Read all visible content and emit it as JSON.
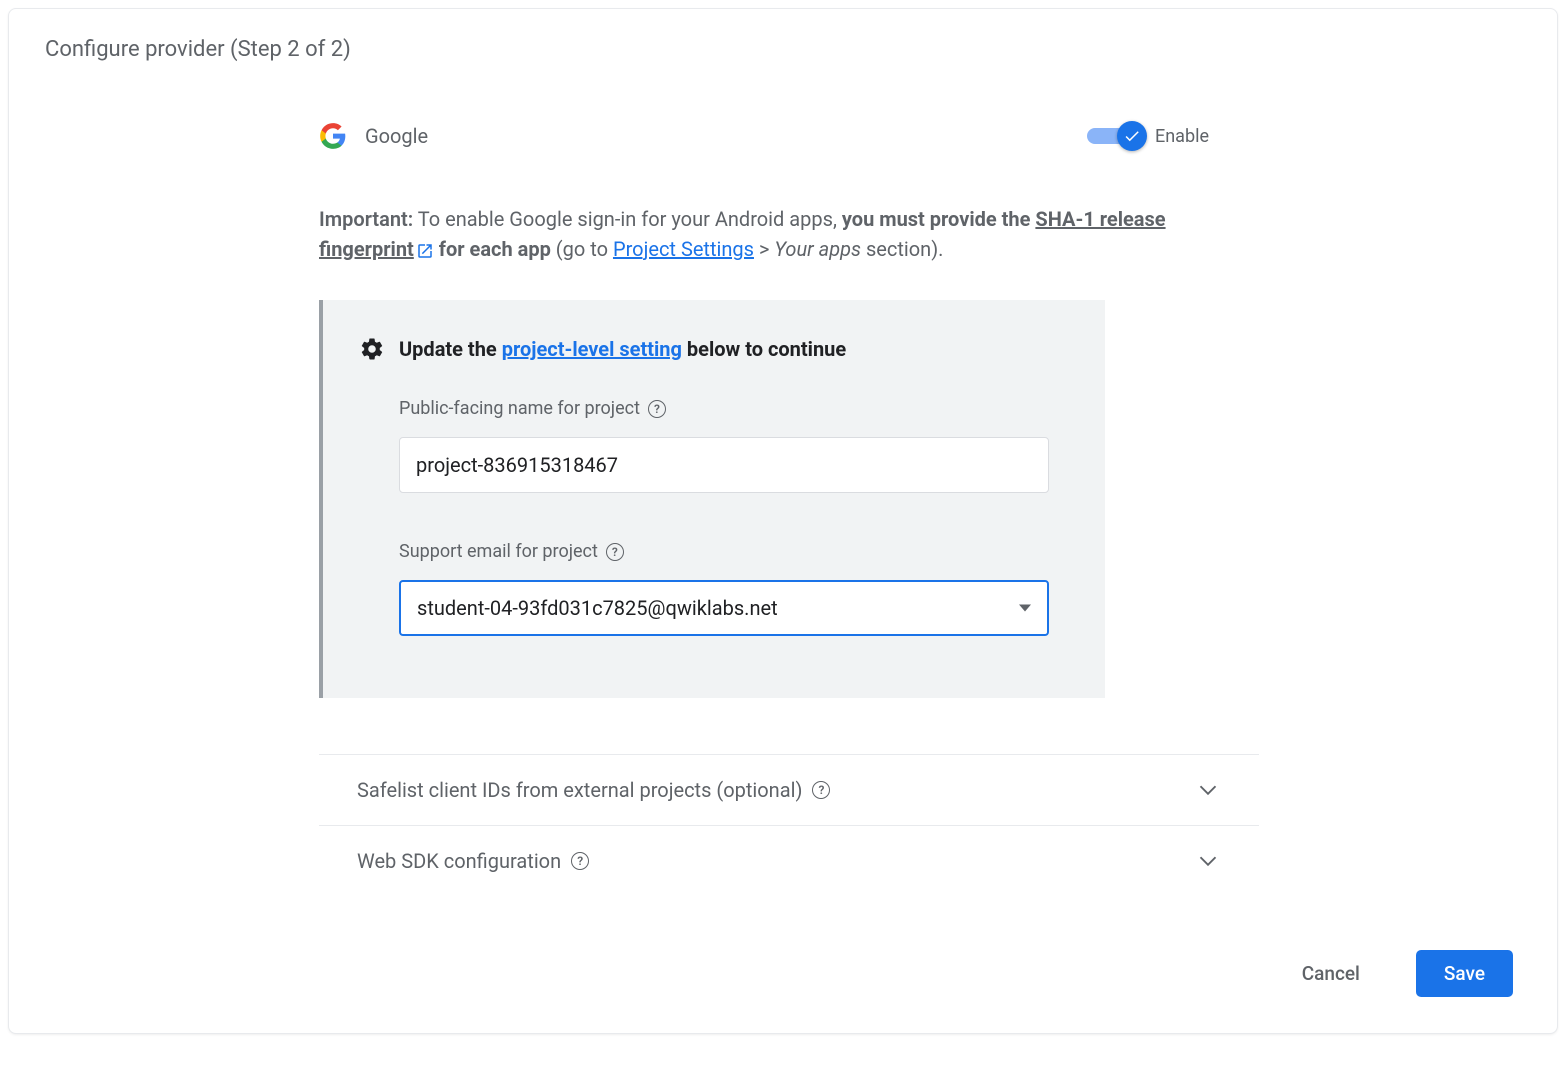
{
  "title": "Configure provider (Step 2 of 2)",
  "provider": {
    "name": "Google",
    "toggle_label": "Enable",
    "enabled": true
  },
  "important": {
    "prefix": "Important:",
    "text1": "To enable Google sign-in for your Android apps,",
    "bold1": "you must provide the",
    "link1": "SHA-1 release fingerprint",
    "bold2": "for each app",
    "text2": "(go to",
    "link2": "Project Settings",
    "text3": ">",
    "italic1": "Your apps",
    "text4": "section)."
  },
  "panel": {
    "header_prefix": "Update the",
    "header_link": "project-level setting",
    "header_suffix": "below to continue",
    "public_name_label": "Public-facing name for project",
    "public_name_value": "project-836915318467",
    "support_email_label": "Support email for project",
    "support_email_value": "student-04-93fd031c7825@qwiklabs.net"
  },
  "sections": {
    "safelist": "Safelist client IDs from external projects (optional)",
    "websdk": "Web SDK configuration"
  },
  "actions": {
    "cancel": "Cancel",
    "save": "Save"
  }
}
